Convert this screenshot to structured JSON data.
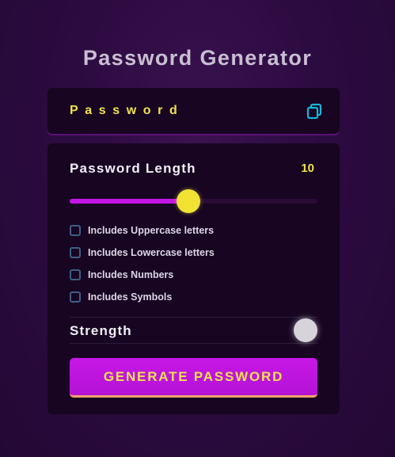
{
  "title": "Password Generator",
  "output": {
    "text": "Password",
    "copy_icon": "copy-icon"
  },
  "length": {
    "label": "Password Length",
    "value": "10",
    "slider_fraction": 0.48
  },
  "options": [
    {
      "label": "Includes Uppercase letters",
      "checked": false
    },
    {
      "label": "Includes Lowercase letters",
      "checked": false
    },
    {
      "label": "Includes Numbers",
      "checked": false
    },
    {
      "label": "Includes Symbols",
      "checked": false
    }
  ],
  "strength": {
    "label": "Strength"
  },
  "generate": {
    "label": "GENERATE PASSWORD"
  },
  "colors": {
    "accent_yellow": "#f1e34a",
    "accent_purple": "#c316e5",
    "panel": "#170521",
    "checkbox_border": "#3d5f86"
  }
}
